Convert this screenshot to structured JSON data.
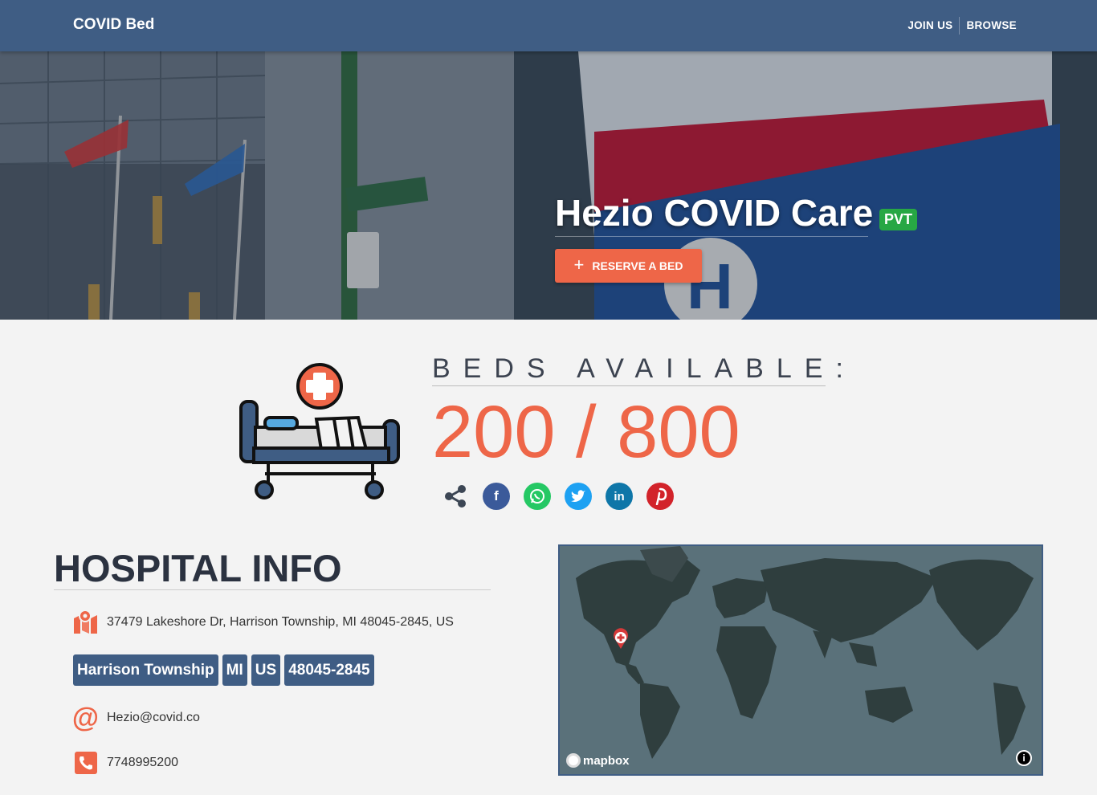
{
  "navbar": {
    "brand": "COVID Bed",
    "links": [
      {
        "label": "JOIN US"
      },
      {
        "label": "BROWSE"
      }
    ]
  },
  "hero": {
    "title": "Hezio COVID Care",
    "badge": "PVT",
    "reserve_label": "RESERVE A BED"
  },
  "beds": {
    "label": "BEDS AVAILABLE:",
    "count": "200 / 800",
    "available": 200,
    "total": 800
  },
  "share": {
    "buttons": [
      {
        "name": "facebook",
        "glyph": "f",
        "color": "#3b5a9a"
      },
      {
        "name": "whatsapp",
        "glyph": "w",
        "color": "#25c864"
      },
      {
        "name": "twitter",
        "glyph": "t",
        "color": "#1da1f2"
      },
      {
        "name": "linkedin",
        "glyph": "in",
        "color": "#0e76a8"
      },
      {
        "name": "pinterest",
        "glyph": "p",
        "color": "#d2232a"
      }
    ]
  },
  "info": {
    "title": "HOSPITAL INFO",
    "address": "37479 Lakeshore Dr, Harrison Township, MI 48045-2845, US",
    "tags": [
      "Harrison Township",
      "MI",
      "US",
      "48045-2845"
    ],
    "email": "Hezio@covid.co",
    "phone": "7748995200"
  },
  "map": {
    "attribution": "mapbox",
    "info_glyph": "i"
  },
  "colors": {
    "primary": "#3f5d84",
    "accent": "#ee6648",
    "badge": "#27a744"
  }
}
